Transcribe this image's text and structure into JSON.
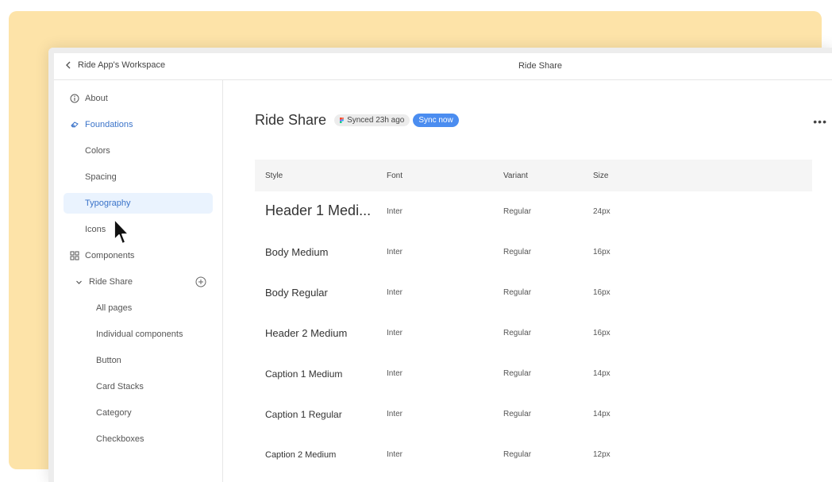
{
  "window": {
    "back_label": "Ride App's Workspace",
    "title": "Ride Share"
  },
  "sidebar": {
    "items": [
      {
        "label": "About",
        "icon": "info-icon"
      },
      {
        "label": "Foundations",
        "icon": "foundations-icon"
      },
      {
        "label": "Colors"
      },
      {
        "label": "Spacing"
      },
      {
        "label": "Typography"
      },
      {
        "label": "Icons"
      },
      {
        "label": "Components",
        "icon": "components-icon"
      },
      {
        "label": "Ride Share",
        "icon": "chevron-down-icon"
      },
      {
        "label": "All pages"
      },
      {
        "label": "Individual components"
      },
      {
        "label": "Button"
      },
      {
        "label": "Card Stacks"
      },
      {
        "label": "Category"
      },
      {
        "label": "Checkboxes"
      }
    ]
  },
  "main": {
    "title": "Ride Share",
    "synced_label": "Synced 23h ago",
    "sync_button": "Sync now",
    "more": "•••"
  },
  "table": {
    "headers": [
      "Style",
      "Font",
      "Variant",
      "Size"
    ],
    "rows": [
      {
        "style": "Header 1 Medi...",
        "font": "Inter",
        "variant": "Regular",
        "size": "24px"
      },
      {
        "style": "Body Medium",
        "font": "Inter",
        "variant": "Regular",
        "size": "16px"
      },
      {
        "style": "Body Regular",
        "font": "Inter",
        "variant": "Regular",
        "size": "16px"
      },
      {
        "style": "Header 2 Medium",
        "font": "Inter",
        "variant": "Regular",
        "size": "16px"
      },
      {
        "style": "Caption 1 Medium",
        "font": "Inter",
        "variant": "Regular",
        "size": "14px"
      },
      {
        "style": "Caption 1 Regular",
        "font": "Inter",
        "variant": "Regular",
        "size": "14px"
      },
      {
        "style": "Caption 2 Medium",
        "font": "Inter",
        "variant": "Regular",
        "size": "12px"
      }
    ]
  },
  "colors": {
    "accent": "#3a73c9",
    "sync_button_bg": "#4b8df0",
    "backdrop": "#fde3a8"
  }
}
